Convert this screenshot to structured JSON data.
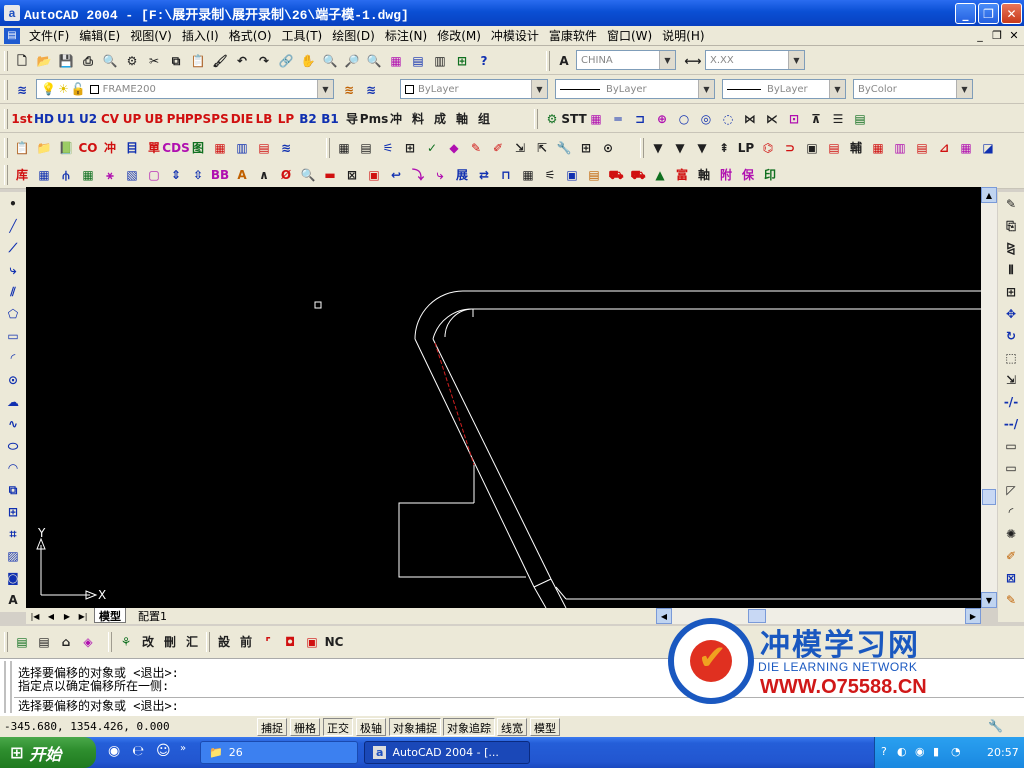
{
  "window": {
    "title": "AutoCAD 2004 - [F:\\展开录制\\展开录制\\26\\端子模-1.dwg]",
    "app_icon": "a",
    "minimize_icon": "minimize-icon",
    "maximize_icon": "restore-icon",
    "close_icon": "close-icon"
  },
  "menu": {
    "items": [
      "文件(F)",
      "编辑(E)",
      "视图(V)",
      "插入(I)",
      "格式(O)",
      "工具(T)",
      "绘图(D)",
      "标注(N)",
      "修改(M)",
      "冲模设计",
      "富康软件",
      "窗口(W)",
      "说明(H)"
    ]
  },
  "toolbar": {
    "text_style": "CHINA",
    "dim_style": "X.XX",
    "layer": "FRAME200",
    "color": "ByLayer",
    "linetype": "ByLayer",
    "lineweight": "ByLayer",
    "plotstyle": "ByColor",
    "row3_labels": [
      "1st",
      "HD",
      "U1",
      "U2",
      "CV",
      "UP",
      "UB",
      "PH",
      "PPS",
      "PS",
      "DIE",
      "LB",
      "LP",
      "B2",
      "B1",
      "导",
      "Pms",
      "冲",
      "料",
      "成",
      "軸",
      "组",
      "STT"
    ],
    "row4_labels": [
      "CO",
      "冲",
      "目",
      "單",
      "CDS",
      "图"
    ],
    "row5_labels": [
      "库",
      "BB",
      "A",
      "∧",
      "Ø",
      "展",
      "富",
      "軸",
      "附",
      "保",
      "印"
    ]
  },
  "tabs": {
    "items": [
      "模型",
      "配置1"
    ],
    "active": "模型"
  },
  "bottom_toolbar": {
    "labels": [
      "改",
      "刪",
      "汇",
      "設",
      "前",
      "NC"
    ]
  },
  "command": {
    "lines": [
      "选择要偏移的对象或 <退出>:",
      "指定点以确定偏移所在一侧:"
    ],
    "prompt": "选择要偏移的对象或 <退出>:"
  },
  "status": {
    "coords": "-345.680, 1354.426, 0.000",
    "toggles": [
      "捕捉",
      "栅格",
      "正交",
      "极轴",
      "对象捕捉",
      "对象追踪",
      "线宽",
      "模型"
    ]
  },
  "ucs": {
    "x_label": "X",
    "y_label": "Y"
  },
  "watermark": {
    "cn": "冲模学习网",
    "en": "DIE LEARNING NETWORK",
    "url": "WWW.O75588.CN"
  },
  "taskbar": {
    "start": "开始",
    "tasks": [
      "26",
      "AutoCAD 2004 - [..."
    ],
    "clock": "20:57"
  },
  "colors": {
    "canvas": "#000000",
    "title_blue": "#0a4fd4",
    "taskbar_blue": "#245ed8",
    "start_green": "#2f8f2f",
    "red_line": "#d02020"
  }
}
